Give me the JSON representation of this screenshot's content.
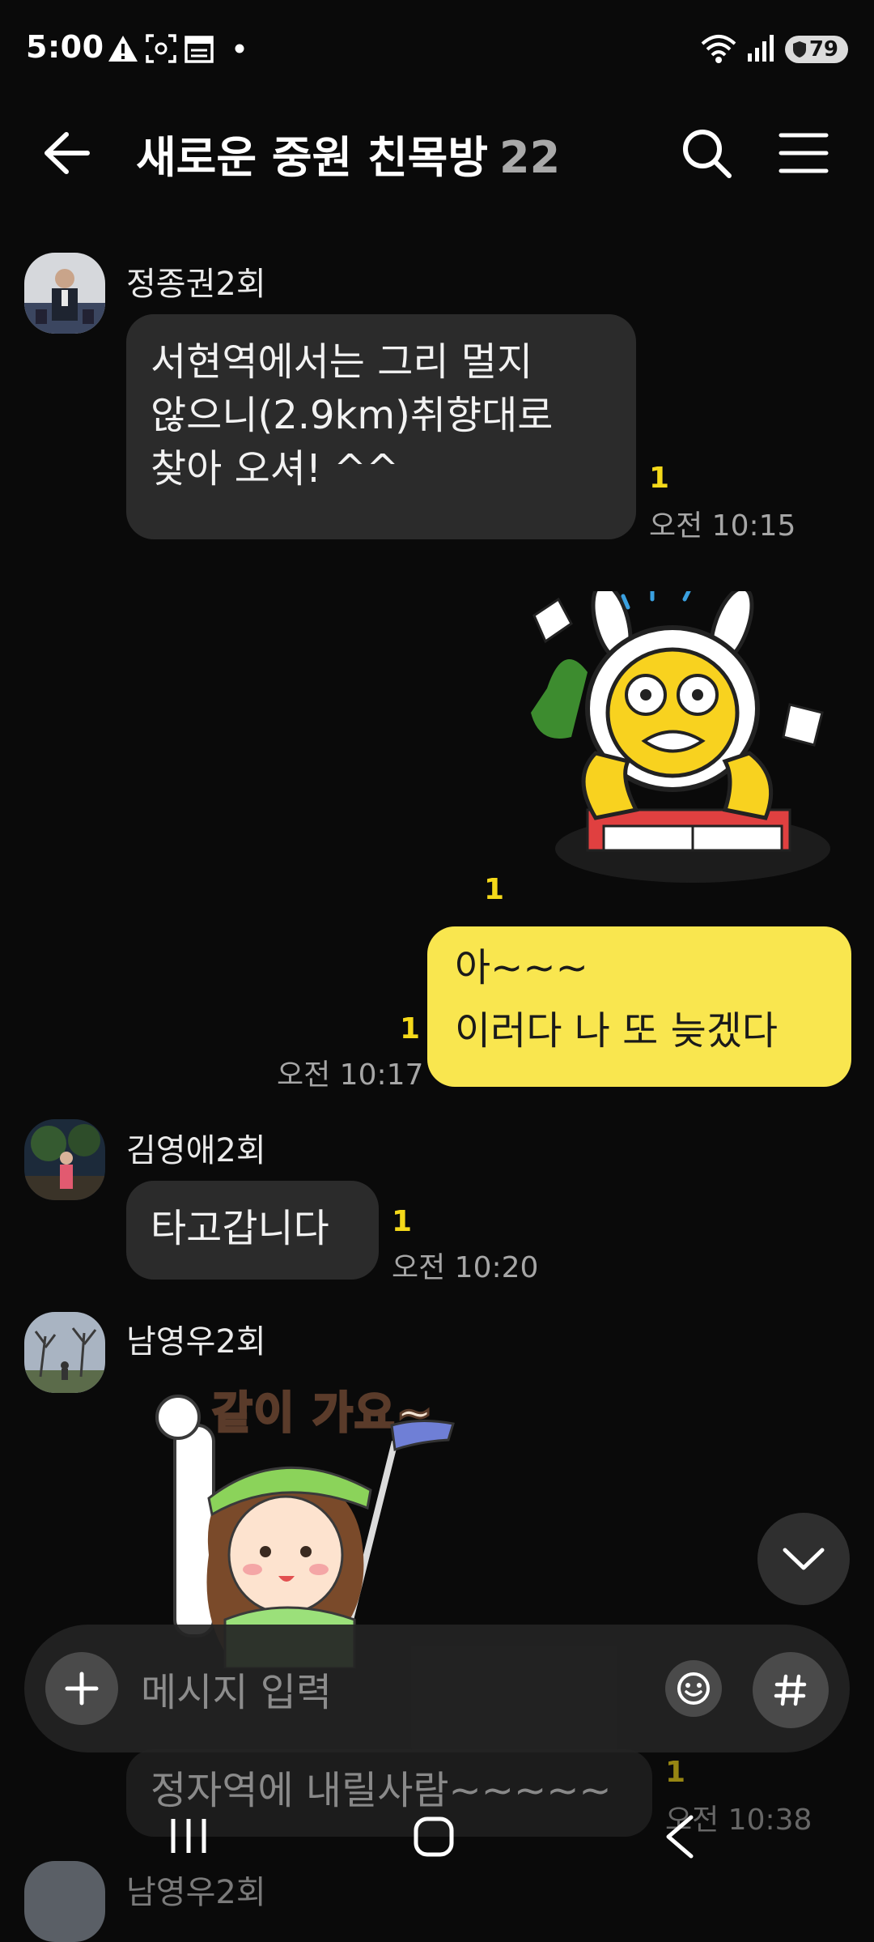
{
  "status_bar": {
    "time": "5:00",
    "battery": "79",
    "icons": [
      "warning-icon",
      "screenshot-icon",
      "calendar-icon",
      "dot-icon",
      "wifi-icon",
      "signal-icon",
      "battery-icon"
    ]
  },
  "header": {
    "title": "새로운 중원 친목방",
    "member_count": "22",
    "icons": [
      "back-arrow-icon",
      "search-icon",
      "menu-icon"
    ]
  },
  "messages": [
    {
      "sender": "정종권2회",
      "lines": [
        "서현역에서는  그리 멀지",
        "않으니(2.9km)취향대로",
        "찾아 오셔! ^^"
      ],
      "unread": "1",
      "time": "오전 10:15"
    },
    {
      "type": "sticker",
      "outgoing": true,
      "unread": "1"
    },
    {
      "outgoing": true,
      "lines": [
        "아~~~",
        "이러다  나 또 늦겠다"
      ],
      "unread": "1",
      "time": "오전 10:17"
    },
    {
      "sender": "김영애2회",
      "lines": [
        "타고갑니다"
      ],
      "unread": "1",
      "time": "오전 10:20"
    },
    {
      "sender": "남영우2회",
      "type": "sticker",
      "sticker_text": "같이 가요~"
    },
    {
      "lines": [
        "정자역에 내릴사람~~~~~"
      ],
      "unread": "1",
      "time": "오전 10:38"
    },
    {
      "sender": "남영우2회"
    }
  ],
  "input": {
    "placeholder": "메시지 입력",
    "icons": [
      "plus-icon",
      "emoji-icon",
      "hashtag-icon"
    ]
  },
  "nav_bar": {
    "icons": [
      "recent-apps-icon",
      "home-icon",
      "back-icon"
    ]
  },
  "colors": {
    "background": "#0a0a0a",
    "incoming_bubble": "#2b2b2b",
    "outgoing_bubble": "#f9e64f",
    "unread": "#f5d91a"
  }
}
